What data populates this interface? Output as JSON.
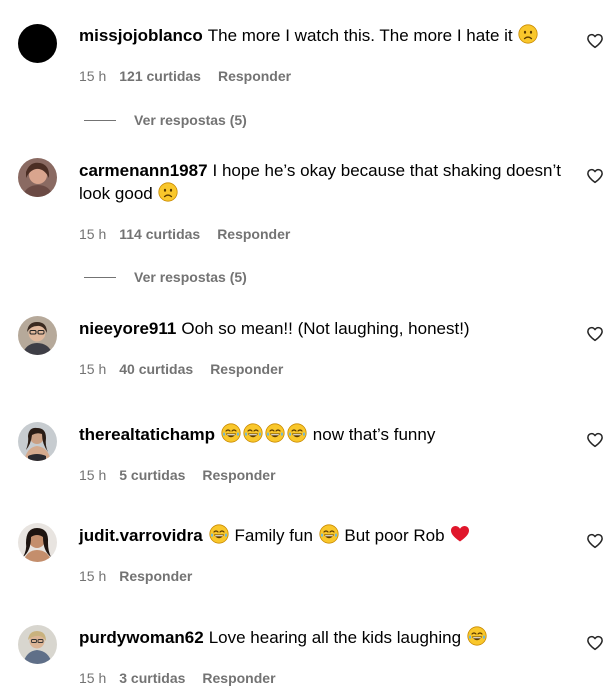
{
  "comments": [
    {
      "username": "missjojoblanco",
      "text": "The more I watch this. The more I hate it",
      "emojis": [
        "sad-face"
      ],
      "time": "15 h",
      "likes": "121 curtidas",
      "reply": "Responder",
      "view_replies": "Ver respostas (5)"
    },
    {
      "username": "carmenann1987",
      "text": "I hope he’s okay because that shaking doesn’t look good",
      "emojis": [
        "sad-face"
      ],
      "time": "15 h",
      "likes": "114 curtidas",
      "reply": "Responder",
      "view_replies": "Ver respostas (5)"
    },
    {
      "username": "nieeyore911",
      "text": "Ooh so mean!! (Not laughing, honest!)",
      "time": "15 h",
      "likes": "40 curtidas",
      "reply": "Responder"
    },
    {
      "username": "therealtatichamp",
      "text": "now that’s funny",
      "emojis": [
        "laughing-face",
        "laughing-face",
        "laughing-face",
        "laughing-face"
      ],
      "time": "15 h",
      "likes": "5 curtidas",
      "reply": "Responder"
    },
    {
      "username": "judit.varrovidra",
      "text_parts": [
        "Family fun",
        "But poor Rob"
      ],
      "emojis": [
        "laughing-face",
        "laughing-face",
        "red-heart"
      ],
      "time": "15 h",
      "reply": "Responder"
    },
    {
      "username": "purdywoman62",
      "text": "Love hearing all the kids laughing",
      "emojis": [
        "laughing-face"
      ],
      "time": "15 h",
      "likes": "3 curtidas",
      "reply": "Responder"
    }
  ],
  "colors": {
    "text": "#000000",
    "meta": "#737373",
    "emoji_yellow": "#f9c72b",
    "heart_red": "#e0162b"
  }
}
